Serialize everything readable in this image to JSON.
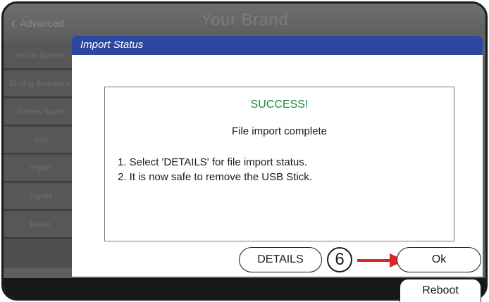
{
  "header": {
    "back_label": "Advanced",
    "brand": "Your Brand"
  },
  "sidebar": {
    "items": [
      {
        "label": "Home Screen"
      },
      {
        "label": "Ending Sequence"
      },
      {
        "label": "Screen Saver"
      },
      {
        "label": "Add"
      },
      {
        "label": "Import"
      },
      {
        "label": "Export"
      },
      {
        "label": "Reset"
      }
    ]
  },
  "dialog": {
    "title": "Import Status",
    "success": "SUCCESS!",
    "message": "File import complete",
    "steps": [
      "1.  Select 'DETAILS' for file import status.",
      "2.  It is now safe to remove the USB Stick."
    ],
    "details_label": "DETAILS",
    "ok_label": "Ok"
  },
  "footer": {
    "reboot_label": "Reboot"
  },
  "annotation": {
    "callout_number": "6",
    "arrow_color": "#d8262c"
  }
}
